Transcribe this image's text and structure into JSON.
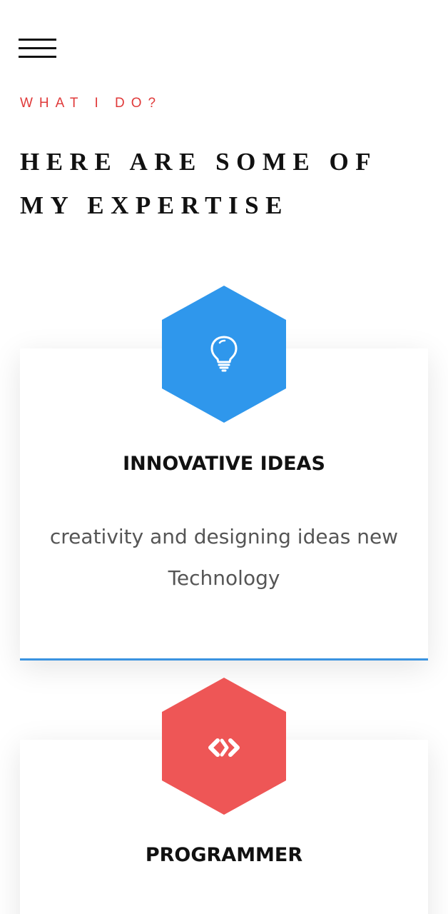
{
  "nav": {
    "menu_icon": "hamburger-menu-icon"
  },
  "section": {
    "eyebrow": "WHAT I DO?",
    "title": "HERE ARE SOME OF MY EXPERTISE"
  },
  "cards": [
    {
      "title": "INNOVATIVE IDEAS",
      "text": "creativity and designing ideas new Technology",
      "icon": "lightbulb-icon",
      "color": "#2f97ec"
    },
    {
      "title": "PROGRAMMER",
      "text": "",
      "icon": "code-icon",
      "color": "#ee5656"
    }
  ]
}
